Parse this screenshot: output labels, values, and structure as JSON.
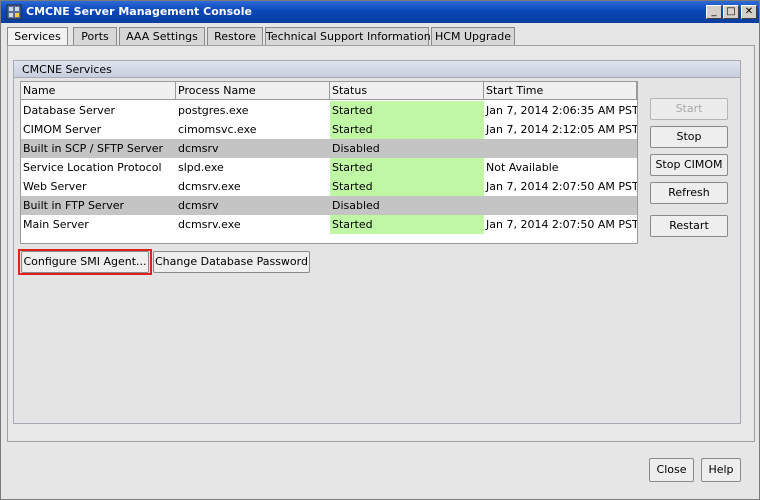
{
  "window": {
    "title": "CMCNE Server Management Console",
    "controls": {
      "minimize": "_",
      "maximize": "□",
      "close": "✕"
    }
  },
  "tabs": [
    {
      "label": "Services"
    },
    {
      "label": "Ports"
    },
    {
      "label": "AAA Settings"
    },
    {
      "label": "Restore"
    },
    {
      "label": "Technical Support Information"
    },
    {
      "label": "HCM Upgrade"
    }
  ],
  "services_group": {
    "title": "CMCNE Services",
    "columns": [
      "Name",
      "Process Name",
      "Status",
      "Start Time"
    ],
    "rows": [
      {
        "name": "Database Server",
        "process": "postgres.exe",
        "status": "Started",
        "start": "Jan 7, 2014 2:06:35 AM PST"
      },
      {
        "name": "CIMOM Server",
        "process": "cimomsvc.exe",
        "status": "Started",
        "start": "Jan 7, 2014 2:12:05 AM PST"
      },
      {
        "name": "Built in SCP / SFTP Server",
        "process": "dcmsrv",
        "status": "Disabled",
        "start": ""
      },
      {
        "name": "Service Location Protocol",
        "process": "slpd.exe",
        "status": "Started",
        "start": "Not Available"
      },
      {
        "name": "Web Server",
        "process": "dcmsrv.exe",
        "status": "Started",
        "start": "Jan 7, 2014 2:07:50 AM PST"
      },
      {
        "name": "Built in FTP Server",
        "process": "dcmsrv",
        "status": "Disabled",
        "start": ""
      },
      {
        "name": "Main Server",
        "process": "dcmsrv.exe",
        "status": "Started",
        "start": "Jan 7, 2014 2:07:50 AM PST"
      }
    ],
    "side_buttons": {
      "start": "Start",
      "stop": "Stop",
      "stop_cimom": "Stop CIMOM",
      "refresh": "Refresh",
      "restart": "Restart"
    },
    "bottom_buttons": {
      "configure_smi": "Configure SMI Agent...",
      "change_db_password": "Change Database Password"
    }
  },
  "footer": {
    "close": "Close",
    "help": "Help"
  },
  "colors": {
    "title_bar": "#0a46b8",
    "status_started": "#bff7a4",
    "disabled_row": "#c4c4c4",
    "highlight": "#e0201f"
  }
}
